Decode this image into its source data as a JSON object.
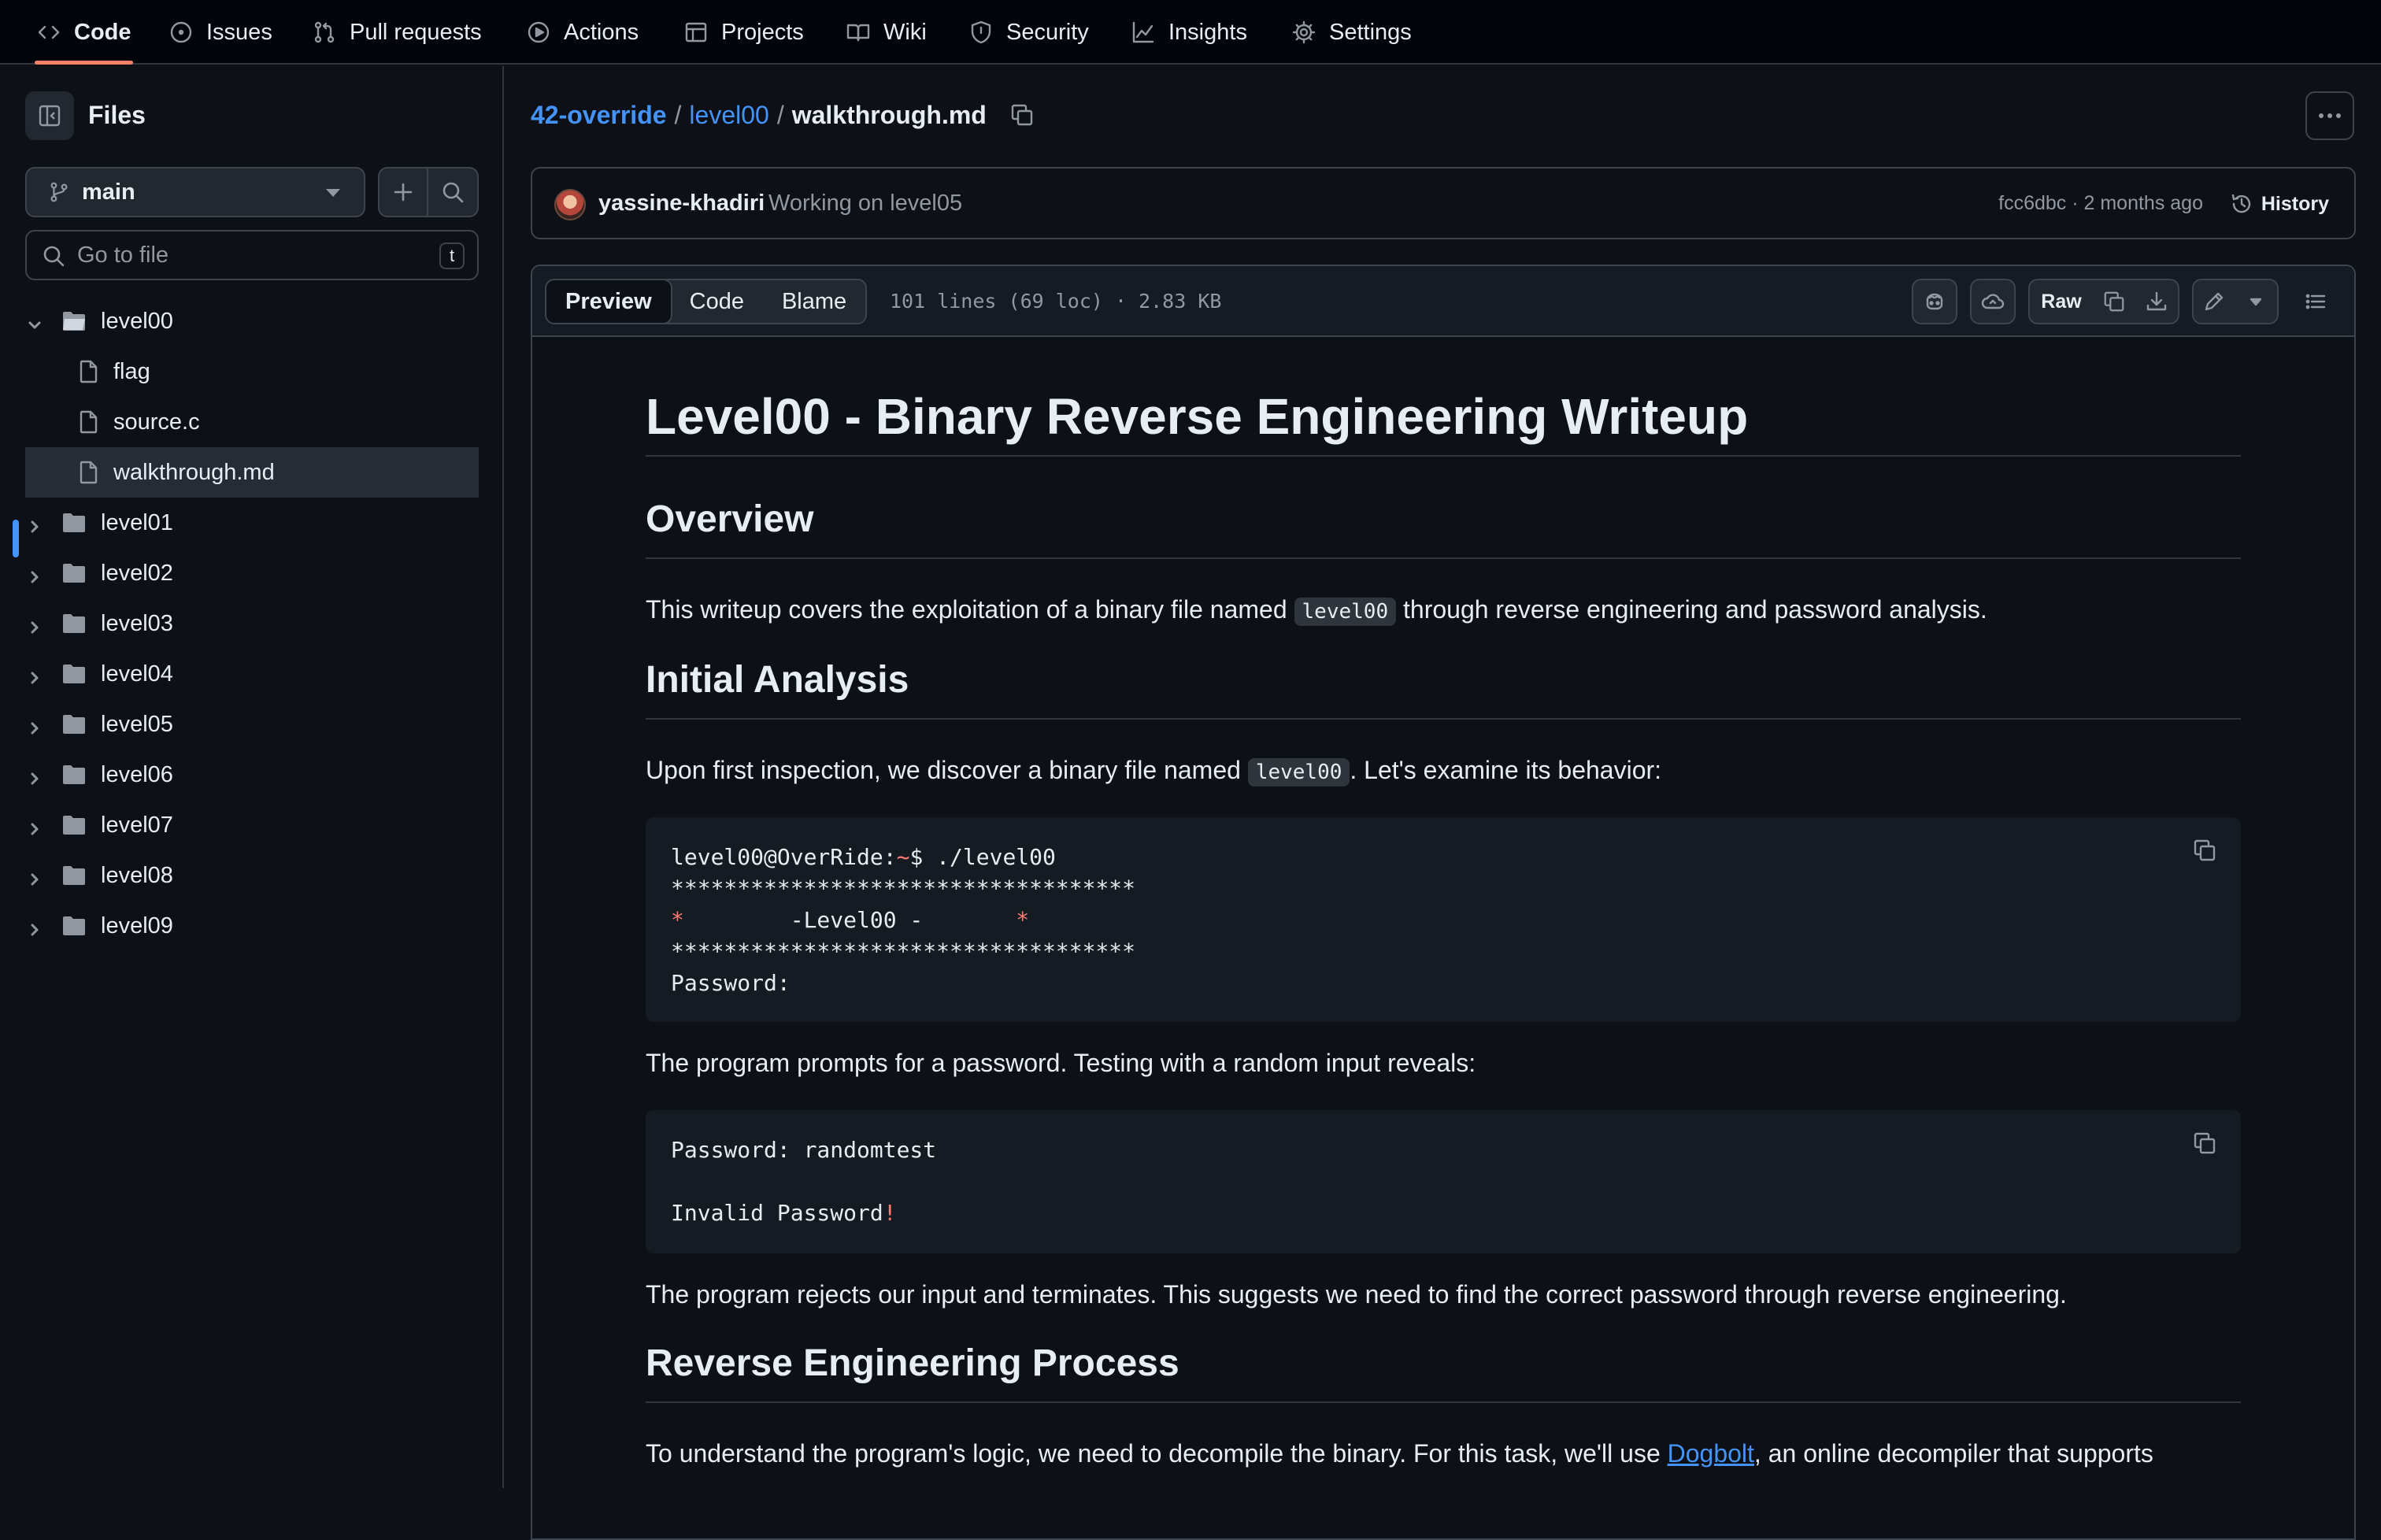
{
  "nav": {
    "tabs": [
      {
        "label": "Code"
      },
      {
        "label": "Issues"
      },
      {
        "label": "Pull requests"
      },
      {
        "label": "Actions"
      },
      {
        "label": "Projects"
      },
      {
        "label": "Wiki"
      },
      {
        "label": "Security"
      },
      {
        "label": "Insights"
      },
      {
        "label": "Settings"
      }
    ],
    "active_tab": "Code"
  },
  "sidebar": {
    "title": "Files",
    "branch": "main",
    "goto_placeholder": "Go to file",
    "goto_shortcut": "t",
    "tree": [
      {
        "name": "level00",
        "type": "folder",
        "expanded": true
      },
      {
        "name": "flag",
        "type": "file"
      },
      {
        "name": "source.c",
        "type": "file"
      },
      {
        "name": "walkthrough.md",
        "type": "file",
        "selected": true
      },
      {
        "name": "level01",
        "type": "folder"
      },
      {
        "name": "level02",
        "type": "folder"
      },
      {
        "name": "level03",
        "type": "folder"
      },
      {
        "name": "level04",
        "type": "folder"
      },
      {
        "name": "level05",
        "type": "folder"
      },
      {
        "name": "level06",
        "type": "folder"
      },
      {
        "name": "level07",
        "type": "folder"
      },
      {
        "name": "level08",
        "type": "folder"
      },
      {
        "name": "level09",
        "type": "folder"
      }
    ]
  },
  "breadcrumb": {
    "repo": "42-override",
    "folder": "level00",
    "file": "walkthrough.md",
    "sep": "/"
  },
  "commit": {
    "author": "yassine-khadiri",
    "message": "Working on level05",
    "hash_time": "fcc6dbc · 2 months ago",
    "history_label": "History"
  },
  "file_header": {
    "tabs": [
      "Preview",
      "Code",
      "Blame"
    ],
    "meta": "101 lines (69 loc) · 2.83 KB",
    "raw_label": "Raw"
  },
  "content": {
    "h1": "Level00 - Binary Reverse Engineering Writeup",
    "overview_h": "Overview",
    "overview_p1": "This writeup covers the exploitation of a binary file named ",
    "overview_code": "level00",
    "overview_p2": " through reverse engineering and password analysis.",
    "initial_h": "Initial Analysis",
    "initial_p1": "Upon first inspection, we discover a binary file named ",
    "initial_code": "level00",
    "initial_p2": ". Let's examine its behavior:",
    "code1": {
      "prompt": "level00@OverRide:",
      "tilde": "~",
      "cmd": "$ ./level00",
      "stars": "***********************************",
      "mid_a": "*",
      "mid_b": "        -Level00 -       ",
      "mid_c": "*",
      "password": "Password:"
    },
    "prompt_p": "The program prompts for a password. Testing with a random input reveals:",
    "code2": {
      "line1": "Password: randomtest",
      "line2": "Invalid Password",
      "bang": "!"
    },
    "rejects_p": "The program rejects our input and terminates. This suggests we need to find the correct password through reverse engineering.",
    "reverse_h": "Reverse Engineering Process",
    "reverse_p1": "To understand the program's logic, we need to decompile the binary. For this task, we'll use ",
    "reverse_link": "Dogbolt",
    "reverse_p2": ", an online decompiler that supports"
  },
  "colors": {
    "accent": "#4493f8",
    "tab_underline": "#f78166",
    "error_red": "#ff7b72",
    "bg": "#0d1117"
  }
}
